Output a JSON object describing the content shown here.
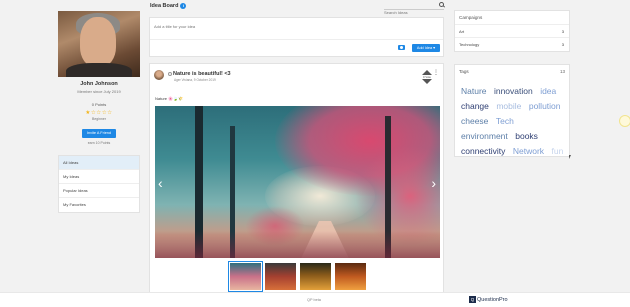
{
  "profile": {
    "name": "John Johnson",
    "member_since": "Member since July 2019",
    "points": "0 Points",
    "stars": "★☆☆☆☆",
    "level": "Beginner",
    "invite_label": "Invite A Friend",
    "earn_text": "earn 10 Points"
  },
  "leftnav": [
    "All Ideas",
    "My Ideas",
    "Popular Ideas",
    "My Favorites"
  ],
  "header": {
    "title": "Idea Board",
    "info_icon": "i",
    "search_placeholder": "Search Ideas"
  },
  "compose": {
    "placeholder": "Add a title for your idea",
    "add_label": "Add Idea ▾"
  },
  "post": {
    "title": "Nature is beautiful! <3",
    "author": "Ager Viviana, 9 October 2019",
    "vote_count": "0 Vote",
    "text": "Nature 🌸🍃🌾",
    "kebab": "⋮",
    "prev_arrow": "‹",
    "next_arrow": "›"
  },
  "campaigns": {
    "title": "Campaigns",
    "items": [
      {
        "label": "Art",
        "count": "3"
      },
      {
        "label": "Technology",
        "count": "3"
      }
    ]
  },
  "tags": {
    "title": "Tags",
    "count": "13",
    "items": [
      "Nature",
      "innovation",
      "idea",
      "change",
      "mobile",
      "pollution",
      "cheese",
      "Tech",
      "environment",
      "books",
      "connectivity",
      "Network",
      "fun"
    ]
  },
  "footer": {
    "mid_text": "QP beta",
    "brand": "QuestionPro",
    "brand_mark": "Q"
  },
  "colors": {
    "accent": "#1e88e5",
    "star": "#f3b51b",
    "nav_active": "#e2eef8"
  }
}
